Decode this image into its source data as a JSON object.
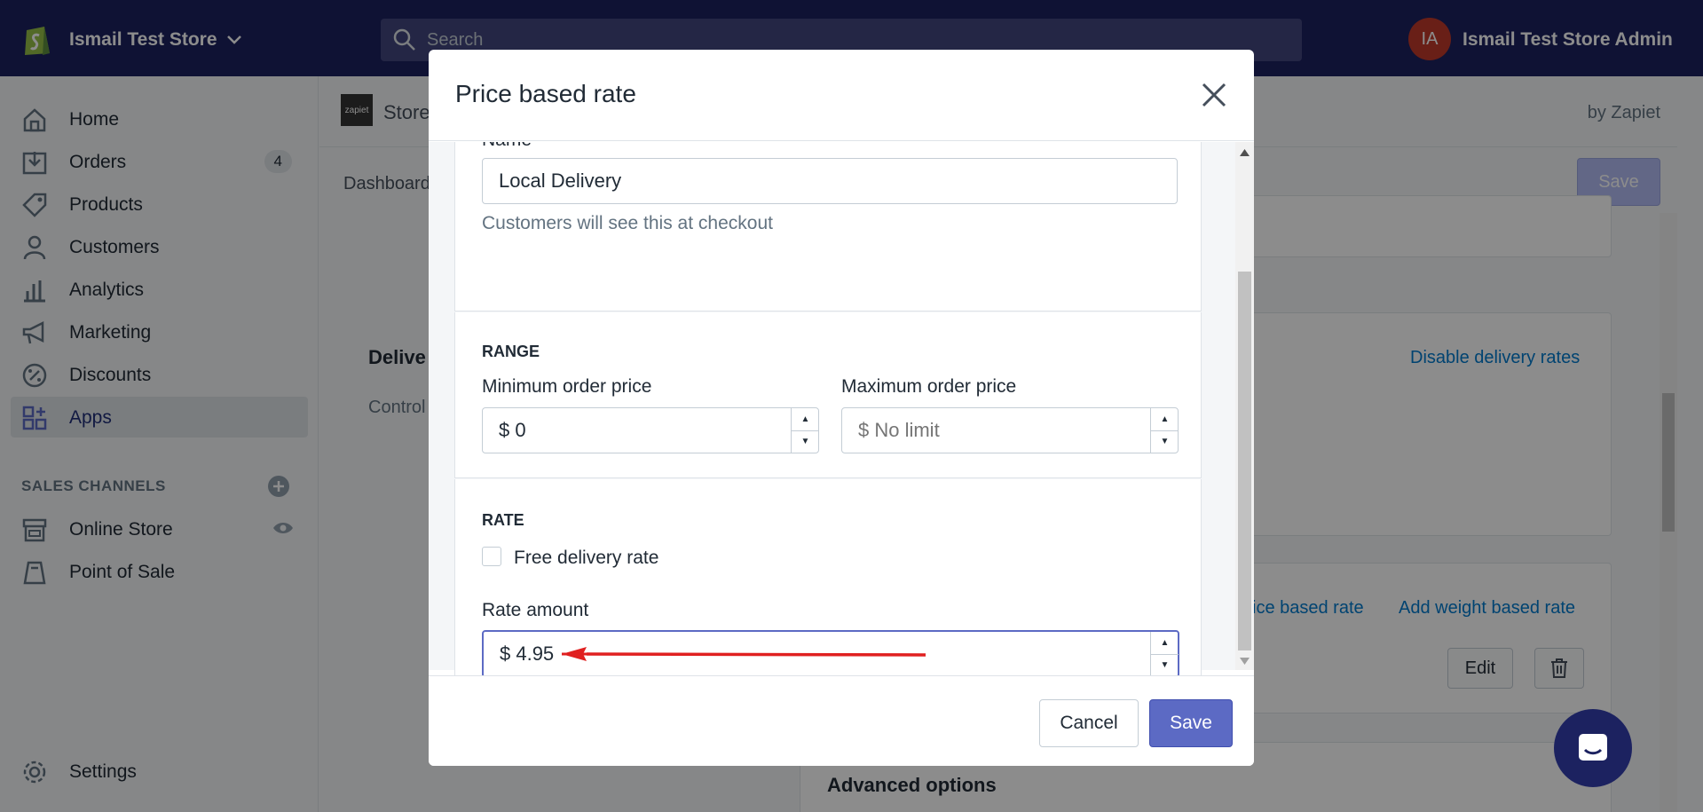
{
  "topbar": {
    "store_name": "Ismail Test Store",
    "search_placeholder": "Search",
    "avatar_initials": "IA",
    "admin_name": "Ismail Test Store Admin"
  },
  "sidebar": {
    "items": [
      {
        "label": "Home"
      },
      {
        "label": "Orders",
        "badge": "4"
      },
      {
        "label": "Products"
      },
      {
        "label": "Customers"
      },
      {
        "label": "Analytics"
      },
      {
        "label": "Marketing"
      },
      {
        "label": "Discounts"
      },
      {
        "label": "Apps"
      }
    ],
    "sales_channels_label": "SALES CHANNELS",
    "channels": [
      {
        "label": "Online Store"
      },
      {
        "label": "Point of Sale"
      }
    ],
    "settings_label": "Settings"
  },
  "background": {
    "app_title": "Store",
    "by_label": "by Zapiet",
    "tab_dashboard": "Dashboard",
    "save_label": "Save",
    "delivery_heading": "Delive",
    "delivery_sub": "Control",
    "disable_link": "Disable delivery rates",
    "price_rate_link": "ice based rate",
    "weight_rate_link": "Add weight based rate",
    "edit_label": "Edit",
    "advanced_options": "Advanced options"
  },
  "modal": {
    "title": "Price based rate",
    "name_label": "Name",
    "name_value": "Local Delivery",
    "name_help": "Customers will see this at checkout",
    "range_heading": "RANGE",
    "min_label": "Minimum order price",
    "min_value": "$ 0",
    "max_label": "Maximum order price",
    "max_placeholder": "$ No limit",
    "rate_heading": "RATE",
    "free_label": "Free delivery rate",
    "rate_label": "Rate amount",
    "rate_value": "$ 4.95",
    "cancel_label": "Cancel",
    "save_label": "Save"
  },
  "colors": {
    "topbar": "#1c2260",
    "primary": "#5c6ac4",
    "link": "#007ace",
    "annotation_arrow": "#e02020"
  }
}
